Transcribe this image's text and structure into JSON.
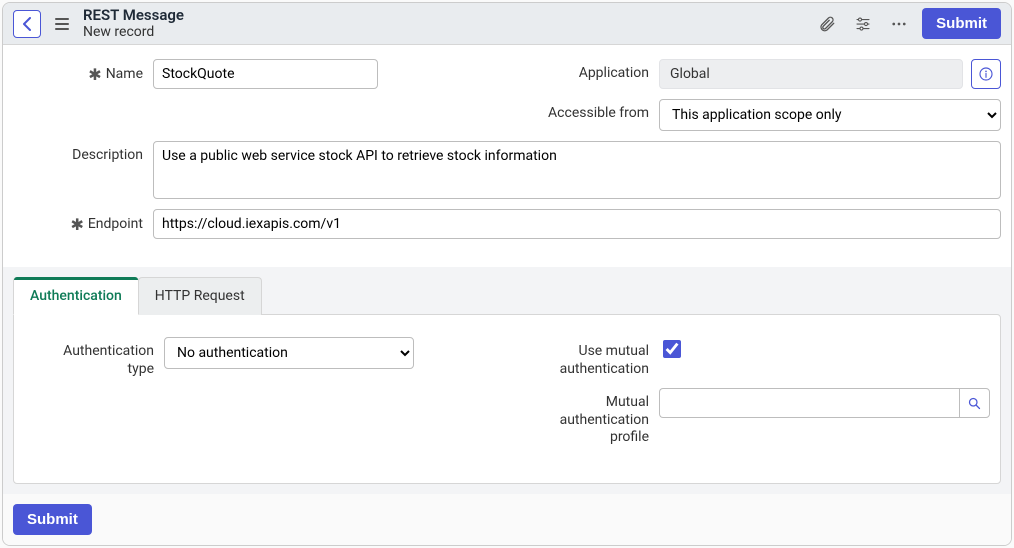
{
  "header": {
    "title": "REST Message",
    "subtitle": "New record",
    "submit_label": "Submit"
  },
  "form": {
    "name_label": "Name",
    "name_value": "StockQuote",
    "application_label": "Application",
    "application_value": "Global",
    "accessible_label": "Accessible from",
    "accessible_value": "This application scope only",
    "description_label": "Description",
    "description_value": "Use a public web service stock API to retrieve stock information",
    "endpoint_label": "Endpoint",
    "endpoint_value": "https://cloud.iexapis.com/v1"
  },
  "tabs": {
    "auth_label": "Authentication",
    "http_label": "HTTP Request"
  },
  "auth": {
    "type_label_line1": "Authentication",
    "type_label_line2": "type",
    "type_value": "No authentication",
    "mutual_label_line1": "Use mutual",
    "mutual_label_line2": "authentication",
    "profile_label_line1": "Mutual",
    "profile_label_line2": "authentication",
    "profile_label_line3": "profile",
    "profile_value": ""
  },
  "footer": {
    "submit_label": "Submit"
  }
}
